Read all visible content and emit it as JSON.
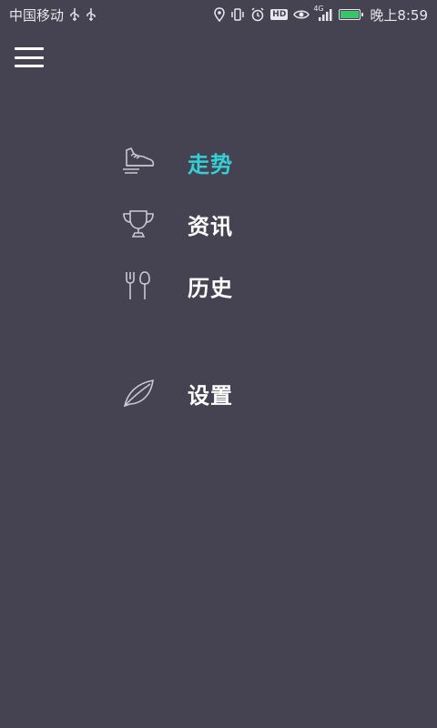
{
  "status_bar": {
    "carrier": "中国移动",
    "network_type": "4G",
    "hd_badge": "HD",
    "time": "晚上8:59",
    "battery_color": "#3ac46b"
  },
  "menu": {
    "accent_color": "#35d0d6",
    "items": [
      {
        "label": "走势",
        "icon": "running-shoe-icon",
        "active": true
      },
      {
        "label": "资讯",
        "icon": "trophy-icon",
        "active": false
      },
      {
        "label": "历史",
        "icon": "fork-spoon-icon",
        "active": false
      },
      {
        "label": "设置",
        "icon": "leaf-icon",
        "active": false
      }
    ]
  }
}
